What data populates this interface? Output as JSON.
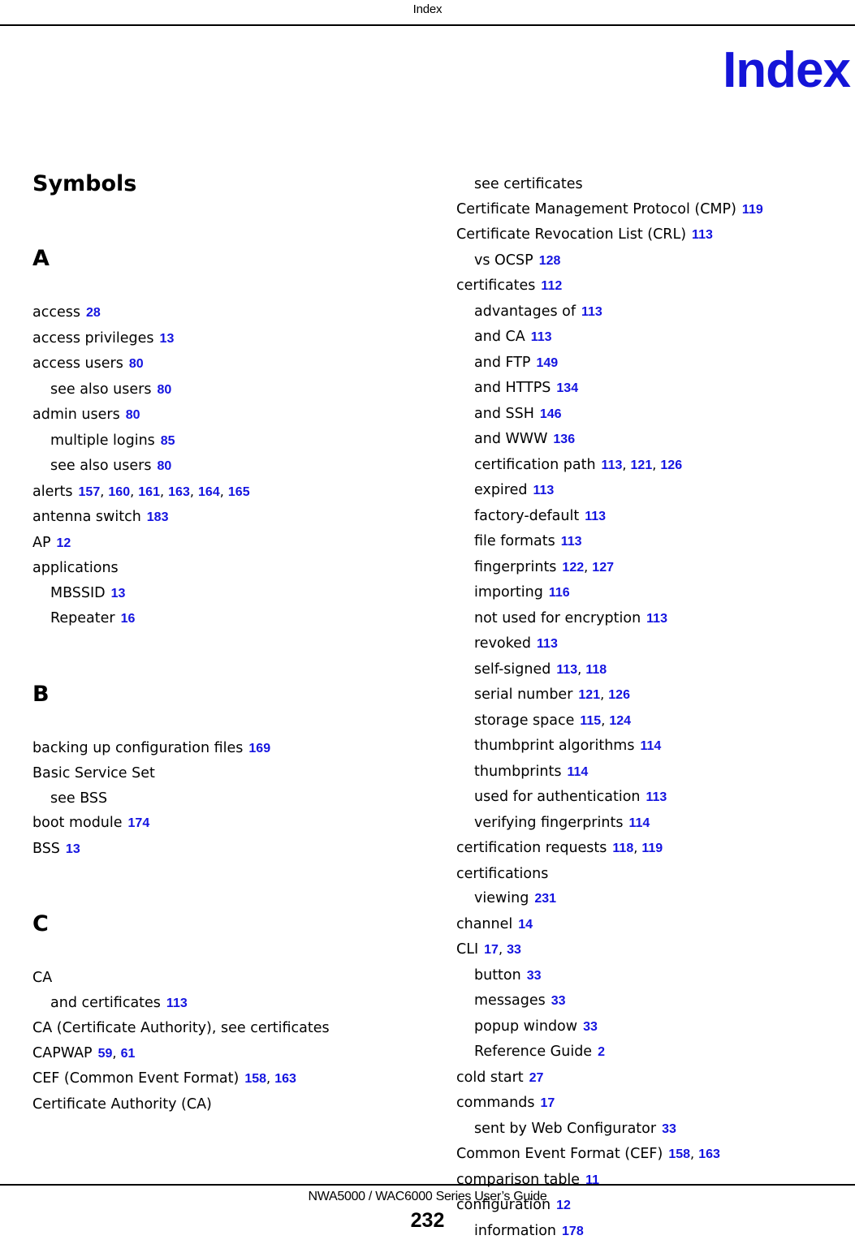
{
  "header": {
    "running_head": "Index"
  },
  "chapter_title": "Index",
  "colors": {
    "page_number_link": "#1414e0",
    "chapter_title": "#1414d8",
    "text": "#000000",
    "background": "#ffffff"
  },
  "footer": {
    "guide_title": "NWA5000 / WAC6000 Series User’s Guide",
    "page_number": "232"
  },
  "columns": {
    "left": [
      {
        "letter": "Symbols",
        "entries": []
      },
      {
        "letter": "A",
        "entries": [
          {
            "level": 1,
            "term": "access",
            "pages": [
              "28"
            ]
          },
          {
            "level": 1,
            "term": "access privileges",
            "pages": [
              "13"
            ]
          },
          {
            "level": 1,
            "term": "access users",
            "pages": [
              "80"
            ]
          },
          {
            "level": 2,
            "term": "see also users",
            "pages": [
              "80"
            ]
          },
          {
            "level": 1,
            "term": "admin users",
            "pages": [
              "80"
            ]
          },
          {
            "level": 2,
            "term": "multiple logins",
            "pages": [
              "85"
            ]
          },
          {
            "level": 2,
            "term": "see also users",
            "pages": [
              "80"
            ]
          },
          {
            "level": 1,
            "term": "alerts",
            "pages": [
              "157",
              "160",
              "161",
              "163",
              "164",
              "165"
            ]
          },
          {
            "level": 1,
            "term": "antenna switch",
            "pages": [
              "183"
            ]
          },
          {
            "level": 1,
            "term": "AP",
            "pages": [
              "12"
            ]
          },
          {
            "level": 1,
            "term": "applications",
            "pages": []
          },
          {
            "level": 2,
            "term": "MBSSID",
            "pages": [
              "13"
            ]
          },
          {
            "level": 2,
            "term": "Repeater",
            "pages": [
              "16"
            ]
          }
        ]
      },
      {
        "letter": "B",
        "entries": [
          {
            "level": 1,
            "term": "backing up configuration files",
            "pages": [
              "169"
            ]
          },
          {
            "level": 1,
            "term": "Basic Service Set",
            "pages": []
          },
          {
            "level": 2,
            "term": "see BSS",
            "pages": []
          },
          {
            "level": 1,
            "term": "boot module",
            "pages": [
              "174"
            ]
          },
          {
            "level": 1,
            "term": "BSS",
            "pages": [
              "13"
            ]
          }
        ]
      },
      {
        "letter": "C",
        "entries": [
          {
            "level": 1,
            "term": "CA",
            "pages": []
          },
          {
            "level": 2,
            "term": "and certificates",
            "pages": [
              "113"
            ]
          },
          {
            "level": 1,
            "term": "CA (Certificate Authority), see certificates",
            "pages": []
          },
          {
            "level": 1,
            "term": "CAPWAP",
            "pages": [
              "59",
              "61"
            ]
          },
          {
            "level": 1,
            "term": "CEF (Common Event Format)",
            "pages": [
              "158",
              "163"
            ]
          },
          {
            "level": 1,
            "term": "Certificate Authority (CA)",
            "pages": []
          }
        ]
      }
    ],
    "right": [
      {
        "letter": "",
        "entries": [
          {
            "level": 2,
            "term": "see certificates",
            "pages": []
          },
          {
            "level": 1,
            "term": "Certificate Management Protocol (CMP)",
            "pages": [
              "119"
            ]
          },
          {
            "level": 1,
            "term": "Certificate Revocation List (CRL)",
            "pages": [
              "113"
            ]
          },
          {
            "level": 2,
            "term": "vs OCSP",
            "pages": [
              "128"
            ]
          },
          {
            "level": 1,
            "term": "certificates",
            "pages": [
              "112"
            ]
          },
          {
            "level": 2,
            "term": "advantages of",
            "pages": [
              "113"
            ]
          },
          {
            "level": 2,
            "term": "and CA",
            "pages": [
              "113"
            ]
          },
          {
            "level": 2,
            "term": "and FTP",
            "pages": [
              "149"
            ]
          },
          {
            "level": 2,
            "term": "and HTTPS",
            "pages": [
              "134"
            ]
          },
          {
            "level": 2,
            "term": "and SSH",
            "pages": [
              "146"
            ]
          },
          {
            "level": 2,
            "term": "and WWW",
            "pages": [
              "136"
            ]
          },
          {
            "level": 2,
            "term": "certification path",
            "pages": [
              "113",
              "121",
              "126"
            ]
          },
          {
            "level": 2,
            "term": "expired",
            "pages": [
              "113"
            ]
          },
          {
            "level": 2,
            "term": "factory-default",
            "pages": [
              "113"
            ]
          },
          {
            "level": 2,
            "term": "file formats",
            "pages": [
              "113"
            ]
          },
          {
            "level": 2,
            "term": "fingerprints",
            "pages": [
              "122",
              "127"
            ]
          },
          {
            "level": 2,
            "term": "importing",
            "pages": [
              "116"
            ]
          },
          {
            "level": 2,
            "term": "not used for encryption",
            "pages": [
              "113"
            ]
          },
          {
            "level": 2,
            "term": "revoked",
            "pages": [
              "113"
            ]
          },
          {
            "level": 2,
            "term": "self-signed",
            "pages": [
              "113",
              "118"
            ]
          },
          {
            "level": 2,
            "term": "serial number",
            "pages": [
              "121",
              "126"
            ]
          },
          {
            "level": 2,
            "term": "storage space",
            "pages": [
              "115",
              "124"
            ]
          },
          {
            "level": 2,
            "term": "thumbprint algorithms",
            "pages": [
              "114"
            ]
          },
          {
            "level": 2,
            "term": "thumbprints",
            "pages": [
              "114"
            ]
          },
          {
            "level": 2,
            "term": "used for authentication",
            "pages": [
              "113"
            ]
          },
          {
            "level": 2,
            "term": "verifying fingerprints",
            "pages": [
              "114"
            ]
          },
          {
            "level": 1,
            "term": "certification requests",
            "pages": [
              "118",
              "119"
            ]
          },
          {
            "level": 1,
            "term": "certifications",
            "pages": []
          },
          {
            "level": 2,
            "term": "viewing",
            "pages": [
              "231"
            ]
          },
          {
            "level": 1,
            "term": "channel",
            "pages": [
              "14"
            ]
          },
          {
            "level": 1,
            "term": "CLI",
            "pages": [
              "17",
              "33"
            ]
          },
          {
            "level": 2,
            "term": "button",
            "pages": [
              "33"
            ]
          },
          {
            "level": 2,
            "term": "messages",
            "pages": [
              "33"
            ]
          },
          {
            "level": 2,
            "term": "popup window",
            "pages": [
              "33"
            ]
          },
          {
            "level": 2,
            "term": "Reference Guide",
            "pages": [
              "2"
            ]
          },
          {
            "level": 1,
            "term": "cold start",
            "pages": [
              "27"
            ]
          },
          {
            "level": 1,
            "term": "commands",
            "pages": [
              "17"
            ]
          },
          {
            "level": 2,
            "term": "sent by Web Configurator",
            "pages": [
              "33"
            ]
          },
          {
            "level": 1,
            "term": "Common Event Format (CEF)",
            "pages": [
              "158",
              "163"
            ]
          },
          {
            "level": 1,
            "term": "comparison table",
            "pages": [
              "11"
            ]
          },
          {
            "level": 1,
            "term": "configuration",
            "pages": [
              "12"
            ]
          },
          {
            "level": 2,
            "term": "information",
            "pages": [
              "178"
            ]
          }
        ]
      }
    ]
  }
}
